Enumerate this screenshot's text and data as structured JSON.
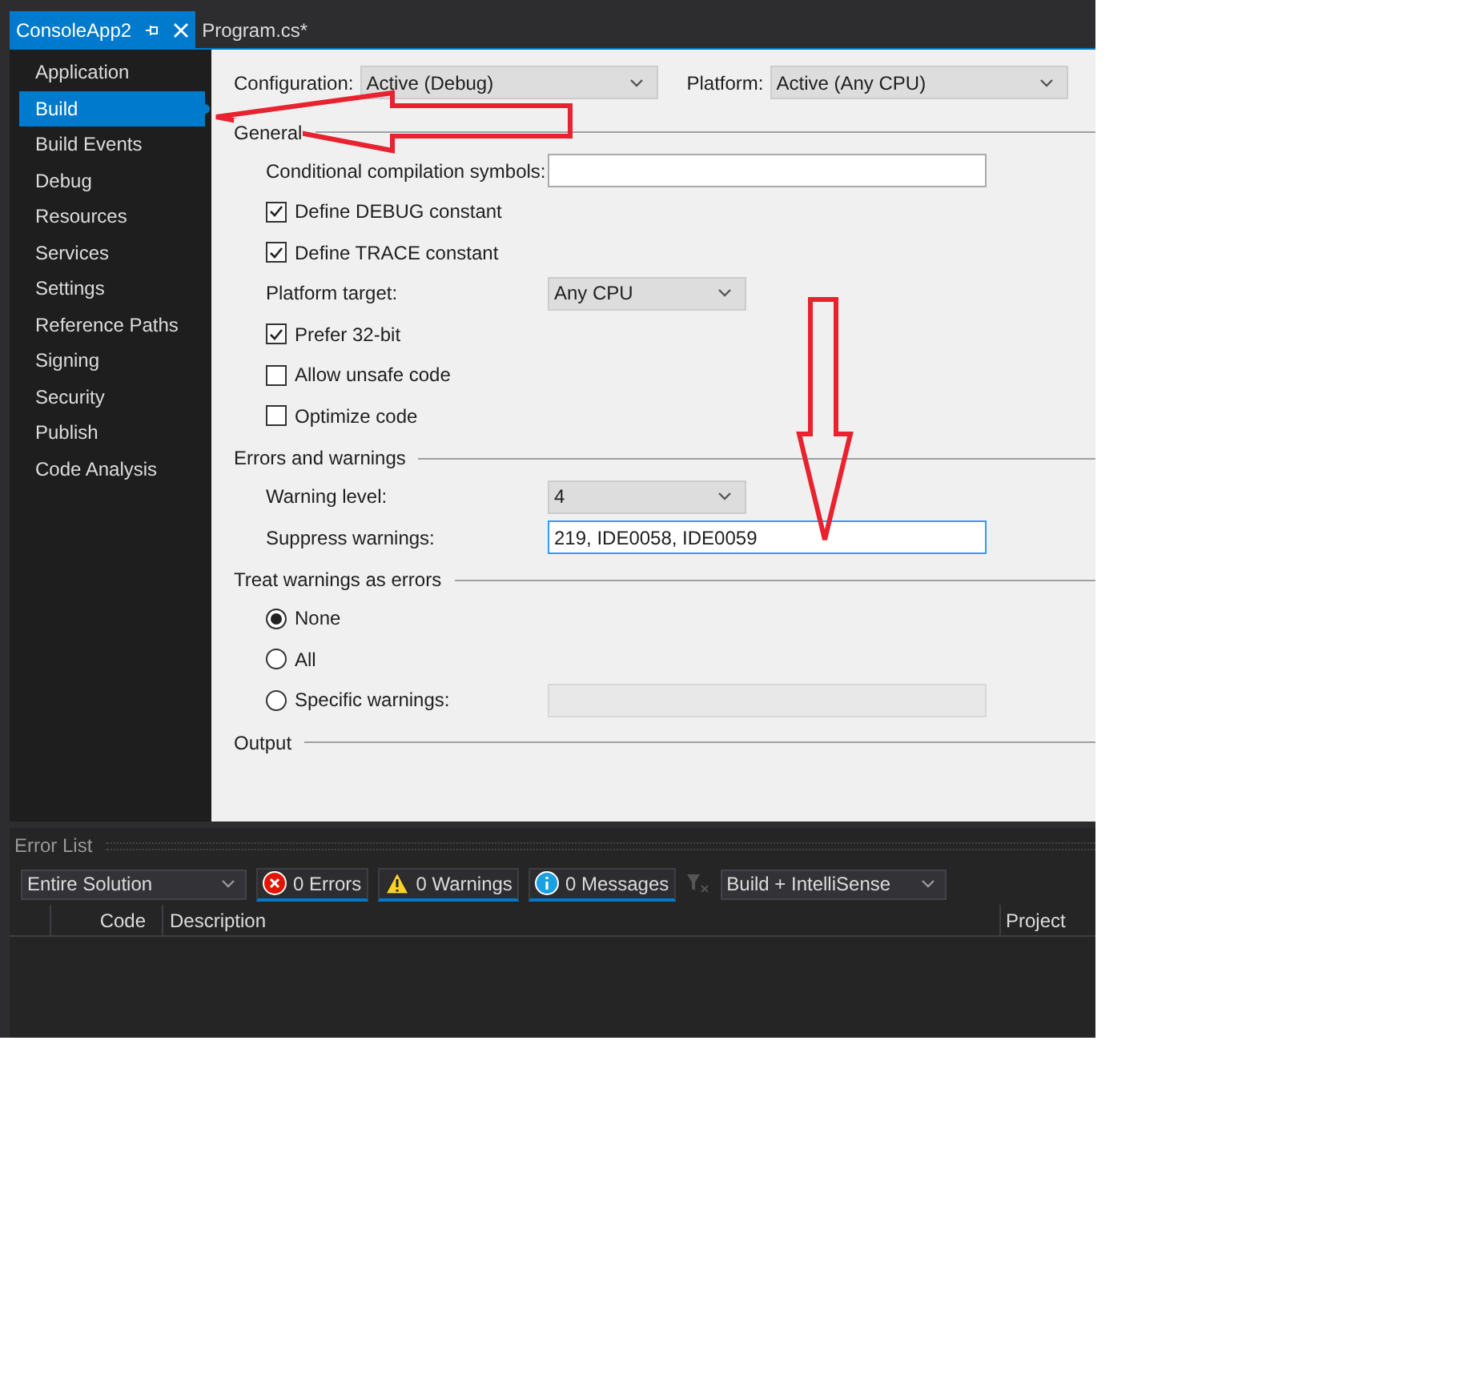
{
  "tabs": [
    {
      "label": "ConsoleApp2",
      "selected": true
    },
    {
      "label": "Program.cs*",
      "selected": false
    }
  ],
  "sidebar": {
    "items": [
      {
        "label": "Application",
        "selected": false
      },
      {
        "label": "Build",
        "selected": true
      },
      {
        "label": "Build Events",
        "selected": false
      },
      {
        "label": "Debug",
        "selected": false
      },
      {
        "label": "Resources",
        "selected": false
      },
      {
        "label": "Services",
        "selected": false
      },
      {
        "label": "Settings",
        "selected": false
      },
      {
        "label": "Reference Paths",
        "selected": false
      },
      {
        "label": "Signing",
        "selected": false
      },
      {
        "label": "Security",
        "selected": false
      },
      {
        "label": "Publish",
        "selected": false
      },
      {
        "label": "Code Analysis",
        "selected": false
      }
    ]
  },
  "config_bar": {
    "configuration": {
      "label": "Configuration:",
      "value": "Active (Debug)"
    },
    "platform": {
      "label": "Platform:",
      "value": "Active (Any CPU)"
    }
  },
  "sections": [
    {
      "title": "General",
      "rows": [
        {
          "kind": "field",
          "label": "Conditional compilation symbols:"
        },
        {
          "kind": "checkbox",
          "label": "Define DEBUG constant",
          "checked": true
        },
        {
          "kind": "checkbox",
          "label": "Define TRACE constant",
          "checked": true
        },
        {
          "kind": "dropdown",
          "label": "Platform target:",
          "value": "Any CPU"
        },
        {
          "kind": "checkbox",
          "label": "Prefer 32-bit",
          "checked": true
        },
        {
          "kind": "checkbox",
          "label": "Allow unsafe code",
          "checked": false
        },
        {
          "kind": "checkbox",
          "label": "Optimize code",
          "checked": false
        }
      ]
    },
    {
      "title": "Errors and warnings",
      "rows": [
        {
          "kind": "dropdown",
          "label": "Warning level:",
          "value": "4"
        },
        {
          "kind": "field",
          "label": "Suppress warnings:",
          "value": "219, IDE0058, IDE0059",
          "focused": true
        }
      ]
    },
    {
      "title": "Treat warnings as errors",
      "rows": [
        {
          "kind": "radio",
          "label": "None",
          "selected": true
        },
        {
          "kind": "radio",
          "label": "All",
          "selected": false
        },
        {
          "kind": "radio",
          "label": "Specific warnings:",
          "selected": false,
          "field": {
            "disabled": true
          }
        }
      ]
    },
    {
      "title": "Output"
    }
  ],
  "error_list": {
    "title": "Error List",
    "scope": "Entire Solution",
    "filters": [
      {
        "kind": "error",
        "label": "0 Errors",
        "selected": true
      },
      {
        "kind": "warning",
        "label": "0 Warnings",
        "selected": true
      },
      {
        "kind": "info",
        "label": "0 Messages",
        "selected": true
      }
    ],
    "source": "Build + IntelliSense",
    "columns": [
      "Code",
      "Description",
      "Project"
    ]
  }
}
